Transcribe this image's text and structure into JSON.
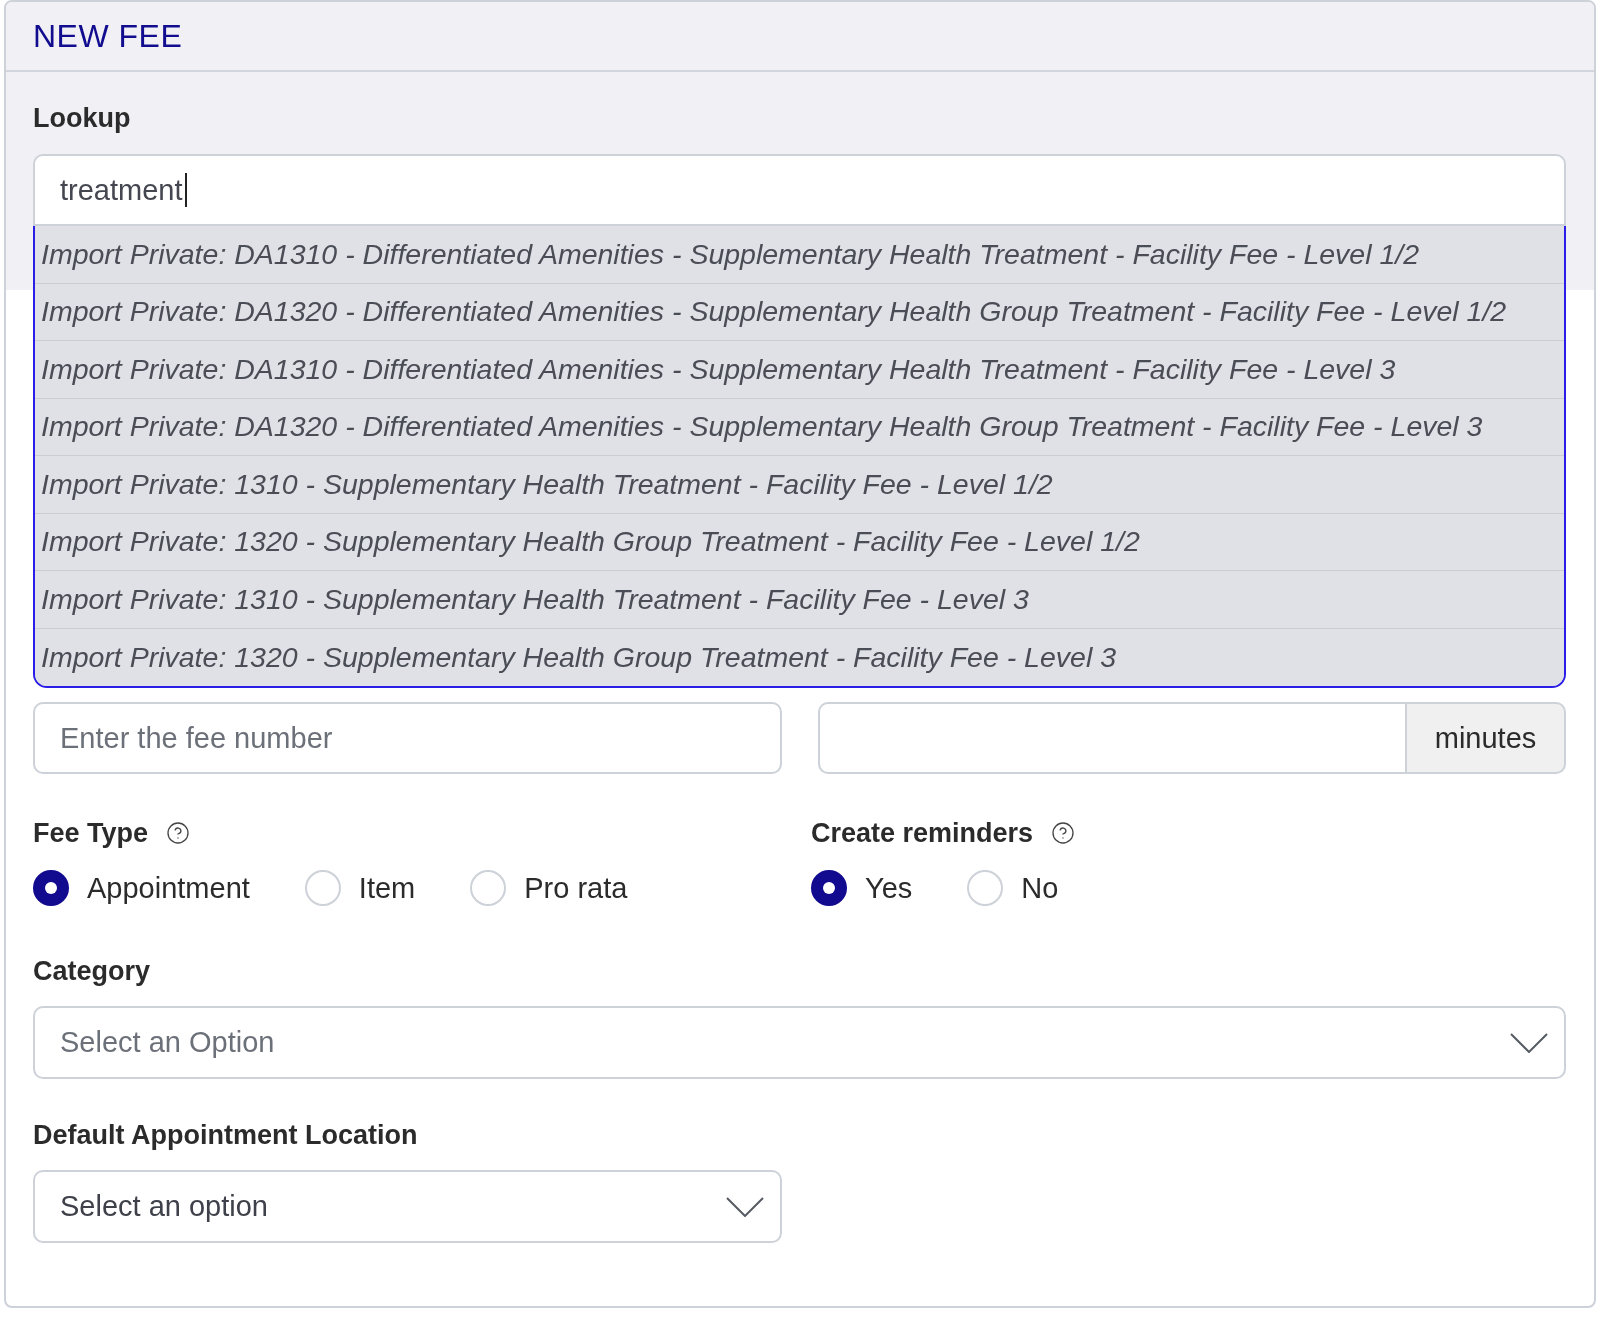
{
  "header": {
    "title": "NEW FEE"
  },
  "lookup": {
    "label": "Lookup",
    "value": "treatment",
    "expanded": true,
    "results": [
      {
        "label": "Import Private: DA1310 - Differentiated Amenities - Supplementary Health Treatment - Facility Fee - Level 1/2",
        "selected": false
      },
      {
        "label": "Import Private: DA1320 - Differentiated Amenities - Supplementary Health Group Treatment - Facility Fee - Level 1/2",
        "selected": false
      },
      {
        "label": "Import Private: DA1310 - Differentiated Amenities - Supplementary Health Treatment - Facility Fee - Level 3",
        "selected": false
      },
      {
        "label": "Import Private: DA1320 - Differentiated Amenities - Supplementary Health Group Treatment - Facility Fee - Level 3",
        "selected": false
      },
      {
        "label": "Import Private: 1310 - Supplementary Health Treatment - Facility Fee - Level 1/2",
        "selected": false
      },
      {
        "label": "Import Private: 1320 - Supplementary Health Group Treatment - Facility Fee - Level 1/2",
        "selected": false
      },
      {
        "label": "Import Private: 1310 - Supplementary Health Treatment - Facility Fee - Level 3",
        "selected": false
      },
      {
        "label": "Import Private: 1320 - Supplementary Health Group Treatment - Facility Fee - Level 3",
        "selected": false
      }
    ]
  },
  "fee_number": {
    "placeholder": "Enter the fee number"
  },
  "duration": {
    "unit": "minutes"
  },
  "fee_type": {
    "label": "Fee Type",
    "options": [
      {
        "label": "Appointment",
        "selected": true
      },
      {
        "label": "Item",
        "selected": false
      },
      {
        "label": "Pro rata",
        "selected": false
      }
    ]
  },
  "create_reminders": {
    "label": "Create reminders",
    "options": [
      {
        "label": "Yes",
        "selected": true
      },
      {
        "label": "No",
        "selected": false
      }
    ]
  },
  "category": {
    "label": "Category",
    "placeholder": "Select an Option"
  },
  "default_location": {
    "label": "Default Appointment Location",
    "value": "Select an option"
  }
}
